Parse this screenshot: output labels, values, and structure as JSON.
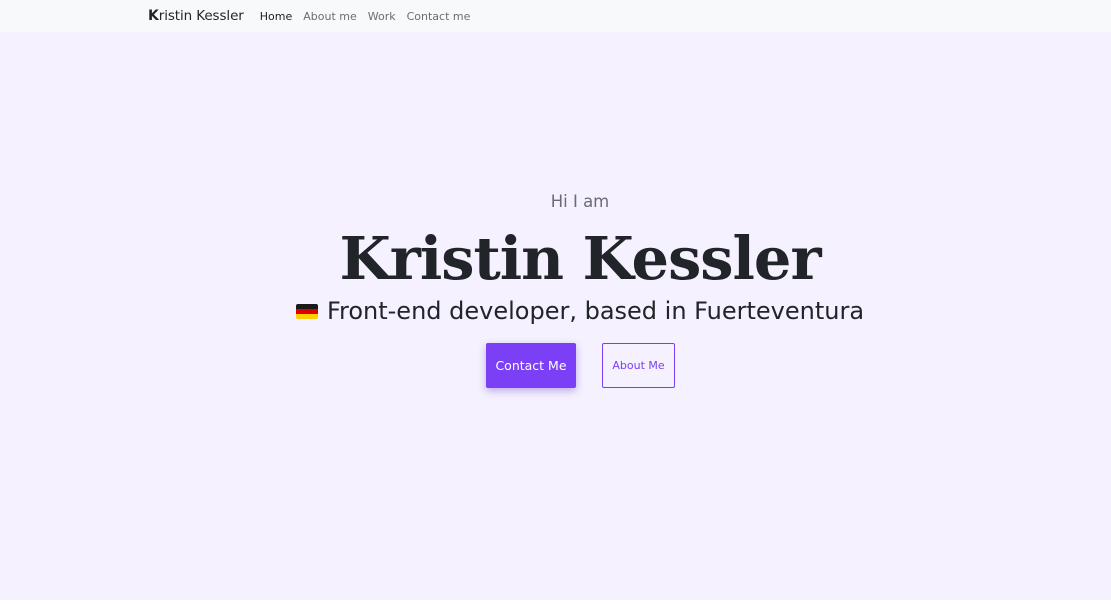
{
  "navbar": {
    "brand_first": "K",
    "brand_rest": "ristin Kessler",
    "links": [
      "Home",
      "About me",
      "Work",
      "Contact me"
    ],
    "active": "Home"
  },
  "hero": {
    "greeting": "Hi I am",
    "name": "Kristin Kessler",
    "flag_icon": "germany-flag-icon",
    "tagline": "Front-end developer, based in Fuerteventura"
  },
  "buttons": {
    "primary_label": "Contact Me",
    "secondary_label": "About Me"
  },
  "colors": {
    "accent": "#7b3ff5",
    "hero_background": "#f5f1fe",
    "navbar_background": "#f8f9fa",
    "text_dark": "#212529",
    "text_muted": "#6b6b78"
  }
}
